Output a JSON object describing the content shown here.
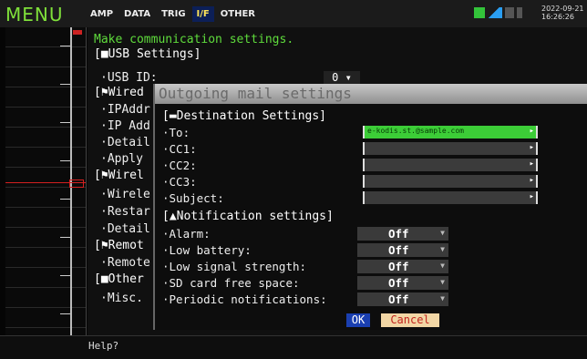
{
  "topbar": {
    "menu_label": "MENU",
    "tabs": [
      "AMP",
      "DATA",
      "TRIG",
      "I/F",
      "OTHER"
    ],
    "active_tab": "I/F",
    "clock_date": "2022-09-21",
    "clock_time": "16:26:26"
  },
  "settings": {
    "help_text": "Make communication settings.",
    "usb_header": "[■USB Settings]",
    "usb_id_label": "·USB ID:",
    "usb_id_value": "0",
    "wired_header": "[⚑Wired",
    "ipaddr_label": "·IPAddr",
    "ipadd2_label": "·IP Add",
    "detail_label": "·Detail",
    "apply_label": "·Apply",
    "wireless_header": "[⚑Wirel",
    "wireless_label": "·Wirele",
    "restart_label": "·Restar",
    "detail2_label": "·Detail",
    "remote_header": "[⚑Remot",
    "remote_label": "·Remote",
    "other_header": "[■Other",
    "misc_label": "·Misc."
  },
  "dialog": {
    "title": "Outgoing mail settings",
    "destination_header": "[▬Destination Settings]",
    "to_label": "·To:",
    "to_value": "e-kodis.st.@sample.com",
    "cc1_label": "·CC1:",
    "cc2_label": "·CC2:",
    "cc3_label": "·CC3:",
    "subject_label": "·Subject:",
    "notification_header": "[▲Notification settings]",
    "alarm_label": "·Alarm:",
    "alarm_value": "Off",
    "low_battery_label": "·Low battery:",
    "low_battery_value": "Off",
    "low_signal_label": "·Low signal strength:",
    "low_signal_value": "Off",
    "sd_label": "·SD card free space:",
    "sd_value": "Off",
    "periodic_label": "·Periodic notifications:",
    "periodic_value": "Off",
    "ok_label": "OK",
    "cancel_label": "Cancel"
  },
  "bottom": {
    "help_label": "Help?"
  },
  "colors": {
    "menu_green": "#7fe03a",
    "help_green": "#5fdc3c",
    "ok_blue": "#1a3fb0",
    "cancel_bg": "#f2d6a5",
    "cancel_text": "#c2241e",
    "trace_red": "#d42020",
    "field_selected": "#3ccd37"
  }
}
